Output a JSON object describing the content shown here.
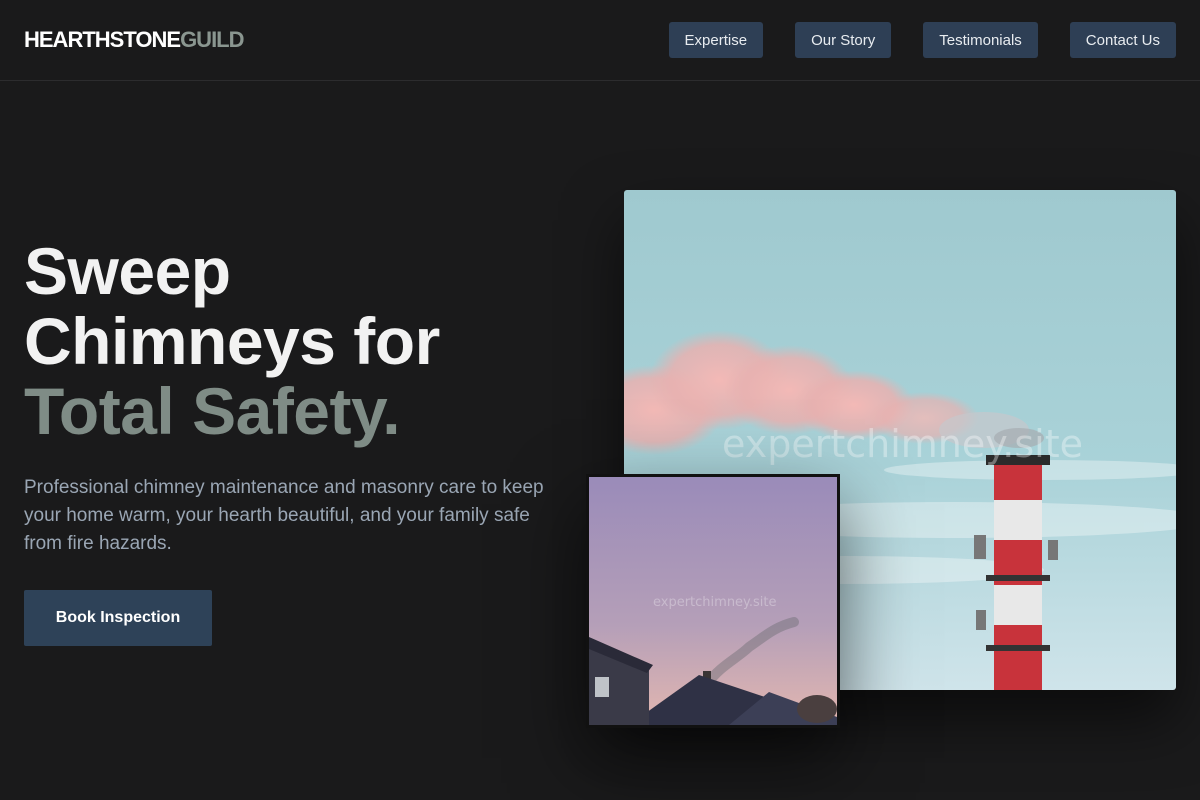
{
  "brand": {
    "part1": "HEARTHSTONE",
    "part2": "GUILD"
  },
  "nav": {
    "items": [
      {
        "label": "Expertise"
      },
      {
        "label": "Our Story"
      },
      {
        "label": "Testimonials"
      },
      {
        "label": "Contact Us"
      }
    ]
  },
  "hero": {
    "title_line1": "Sweep",
    "title_line2": "Chimneys for",
    "title_line3": "Total Safety.",
    "description": "Professional chimney maintenance and masonry care to keep your home warm, your hearth beautiful, and your family safe from fire hazards.",
    "cta_label": "Book Inspection"
  },
  "images": {
    "main_watermark": "expertchimney.site",
    "secondary_watermark": "expertchimney.site"
  },
  "colors": {
    "background": "#1a1a1b",
    "accent_button": "#2e3f55",
    "muted_green": "#7f8c86"
  }
}
